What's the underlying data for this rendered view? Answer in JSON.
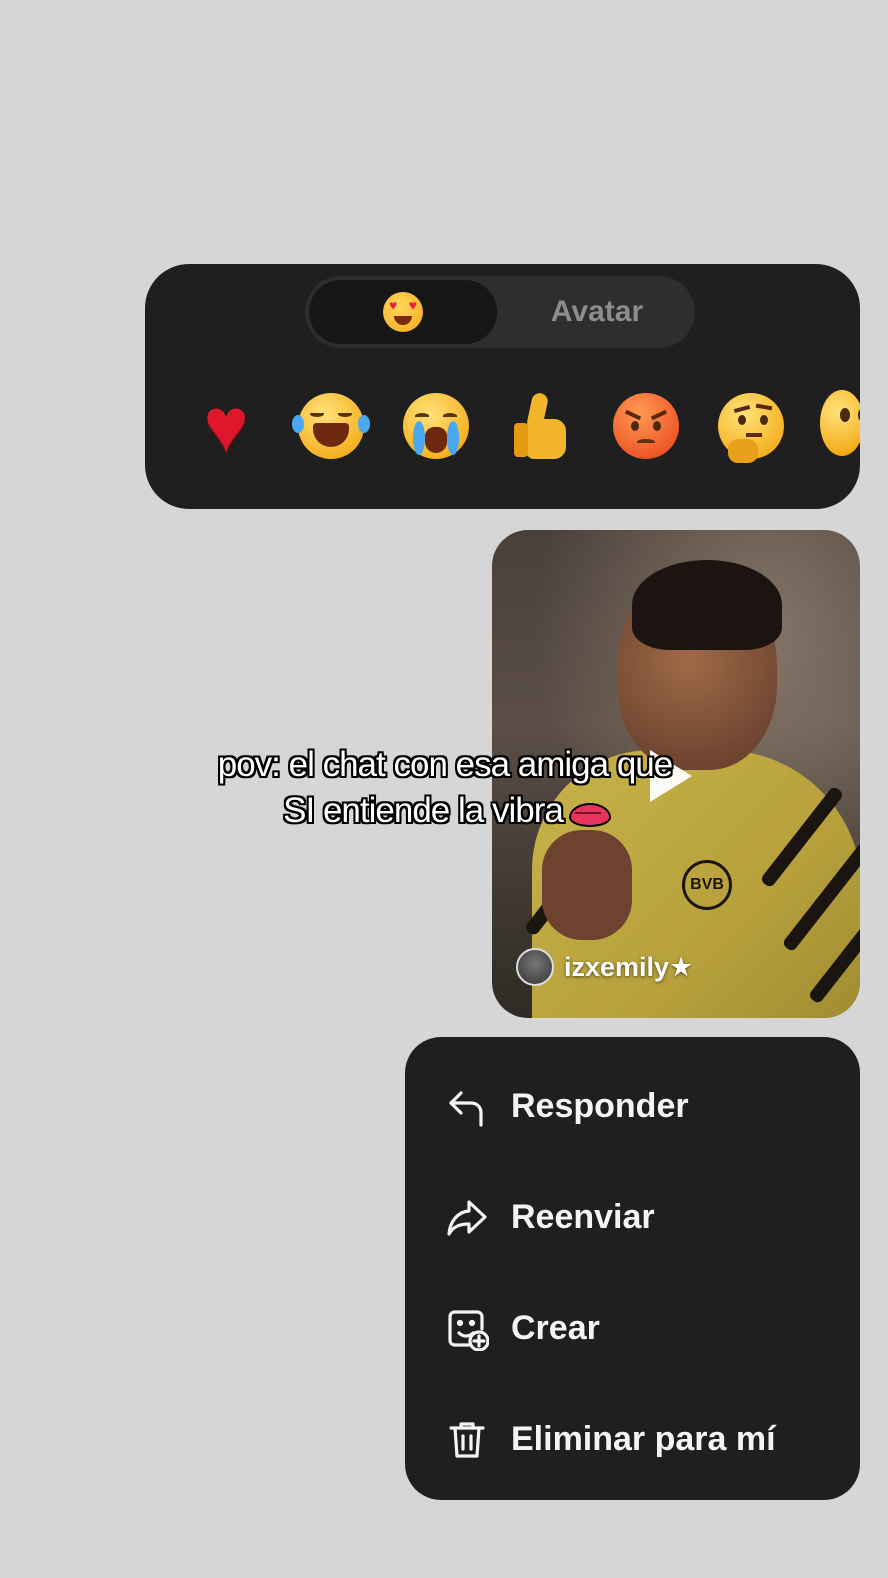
{
  "reaction_panel": {
    "segments": [
      {
        "icon": "heart-eyes-emoji-icon",
        "selected": true
      },
      {
        "label": "Avatar",
        "selected": false
      }
    ],
    "reactions": [
      {
        "icon": "red-heart-emoji"
      },
      {
        "icon": "tears-of-joy-emoji"
      },
      {
        "icon": "loudly-crying-emoji"
      },
      {
        "icon": "thumbs-up-emoji"
      },
      {
        "icon": "angry-face-emoji"
      },
      {
        "icon": "thinking-face-emoji"
      },
      {
        "icon": "astonished-face-emoji"
      }
    ]
  },
  "video_message": {
    "author": "izxemily★",
    "play_icon": "play-icon"
  },
  "caption": {
    "line1": "pov: el chat con esa amiga que",
    "line2": "SI entiende la vibra"
  },
  "context_menu": {
    "items": [
      {
        "label": "Responder",
        "icon": "reply-arrow-icon"
      },
      {
        "label": "Reenviar",
        "icon": "forward-arrow-icon"
      },
      {
        "label": "Crear",
        "icon": "create-sticker-icon"
      },
      {
        "label": "Eliminar para mí",
        "icon": "trash-icon"
      }
    ]
  },
  "colors": {
    "background": "#d6d6d7",
    "panel": "#1f1f20",
    "text": "#f4f4f4"
  }
}
